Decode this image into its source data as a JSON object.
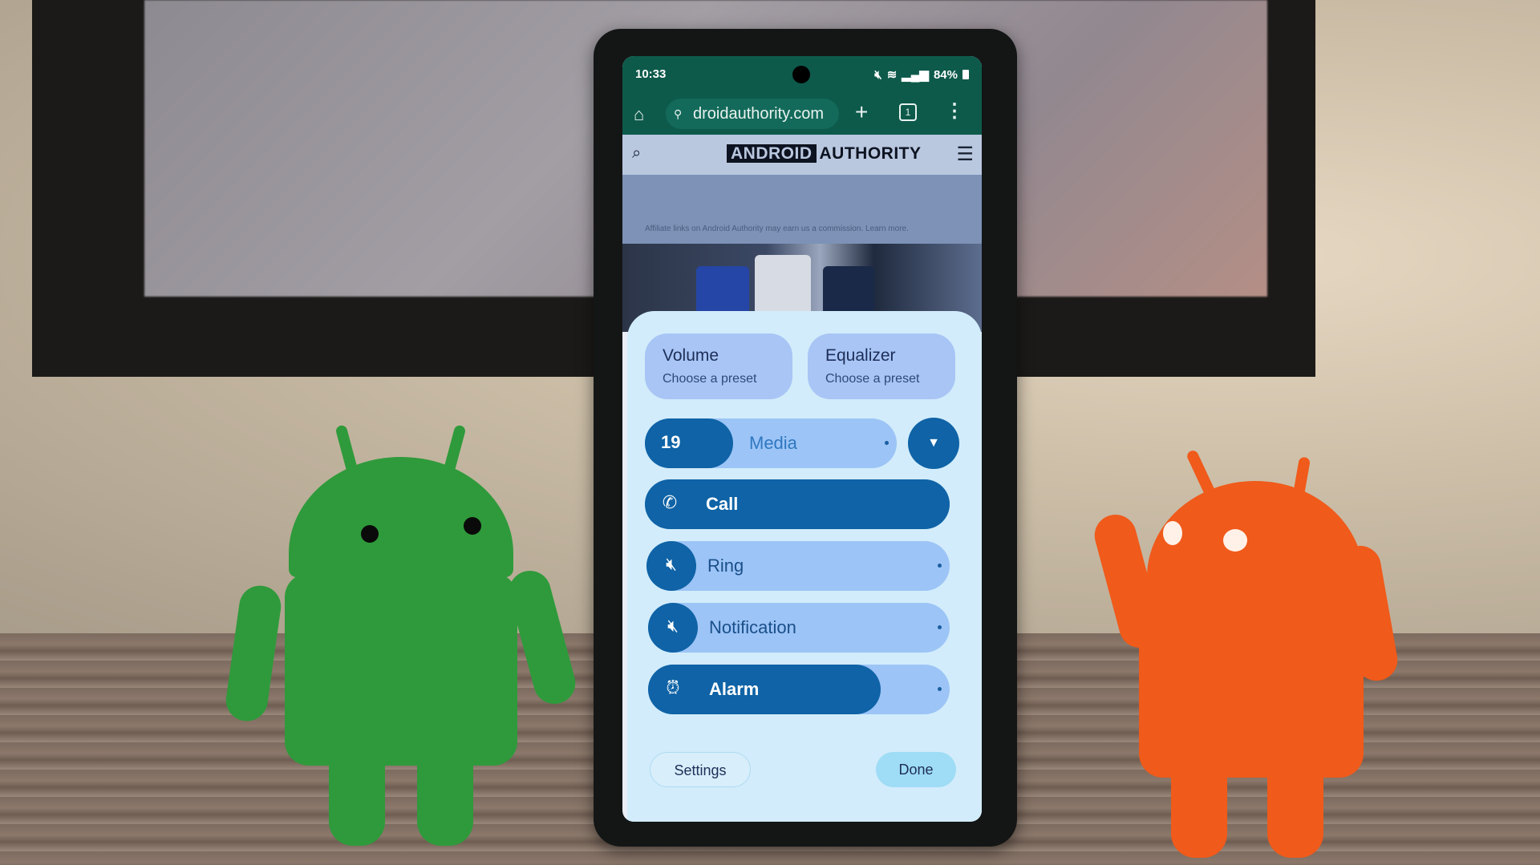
{
  "status_bar": {
    "time": "10:33",
    "battery": "84%",
    "icons": [
      "activity-icon",
      "mute-icon",
      "wifi-icon",
      "signal-icon",
      "battery-icon"
    ]
  },
  "browser": {
    "url": "droidauthority.com",
    "tab_count": "1",
    "icons": {
      "home": "⌂",
      "tune": "⚙",
      "plus": "+",
      "menu": "⋮"
    }
  },
  "website": {
    "logo_boxed": "ANDROID",
    "logo_text": "AUTHORITY",
    "affiliate_text": "Affiliate links on Android Authority may earn us a commission. Learn more."
  },
  "volume_panel": {
    "presets": [
      {
        "title": "Volume",
        "subtitle": "Choose a preset"
      },
      {
        "title": "Equalizer",
        "subtitle": "Choose a preset"
      }
    ],
    "media": {
      "label": "Media",
      "value": "19",
      "level": 0.25
    },
    "sliders": [
      {
        "label": "Call",
        "icon": "phone-icon",
        "level": 1.0
      },
      {
        "label": "Ring",
        "icon": "muted-vibrate-icon",
        "level": 0.0
      },
      {
        "label": "Notification",
        "icon": "muted-vibrate-icon",
        "level": 0.0
      },
      {
        "label": "Alarm",
        "icon": "alarm-icon",
        "level": 0.77
      }
    ],
    "settings_label": "Settings",
    "done_label": "Done"
  },
  "colors": {
    "accent": "#0f63a6",
    "track": "#9cc4f6",
    "panel": "#d2ecfb",
    "browser_bar": "#0d5a4b"
  }
}
